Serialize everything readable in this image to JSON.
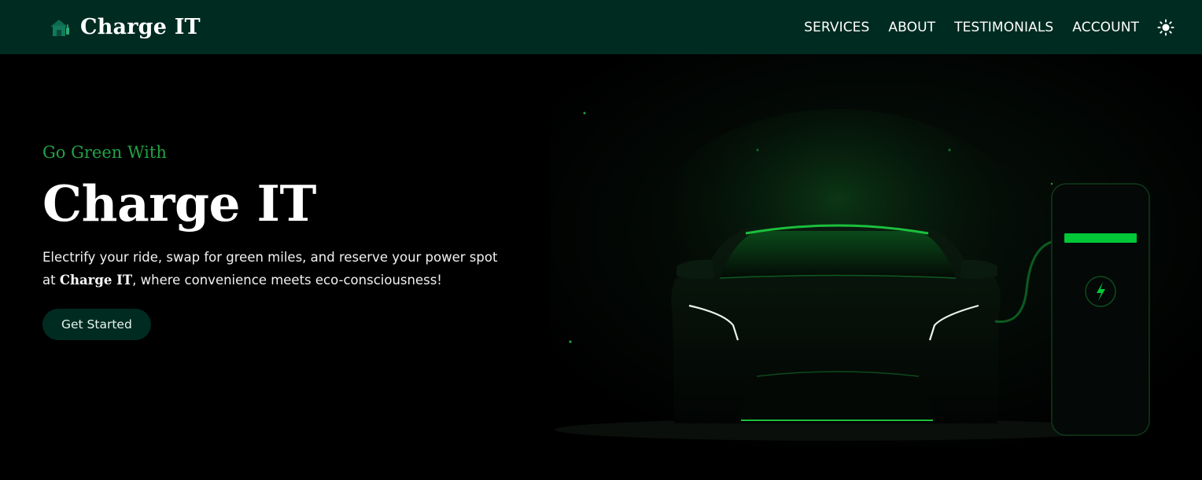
{
  "navbar": {
    "logo_icon": "house-charger-icon",
    "brand": "Charge IT",
    "links": [
      "SERVICES",
      "ABOUT",
      "TESTIMONIALS",
      "ACCOUNT"
    ],
    "theme_icon": "sun-icon"
  },
  "hero": {
    "eyebrow": "Go Green With",
    "title": "Charge IT",
    "description_part1": "Electrify your ride, swap for green miles, and reserve your power spot at",
    "description_brand": "Charge IT",
    "description_part2": ", where convenience meets eco-consciousness!",
    "cta_label": "Get Started",
    "illustration": "electric-car-charging-illustration"
  },
  "colors": {
    "nav_bg": "#002b20",
    "accent_green": "#22a244",
    "neon_green": "#00c837",
    "page_bg": "#000000"
  }
}
